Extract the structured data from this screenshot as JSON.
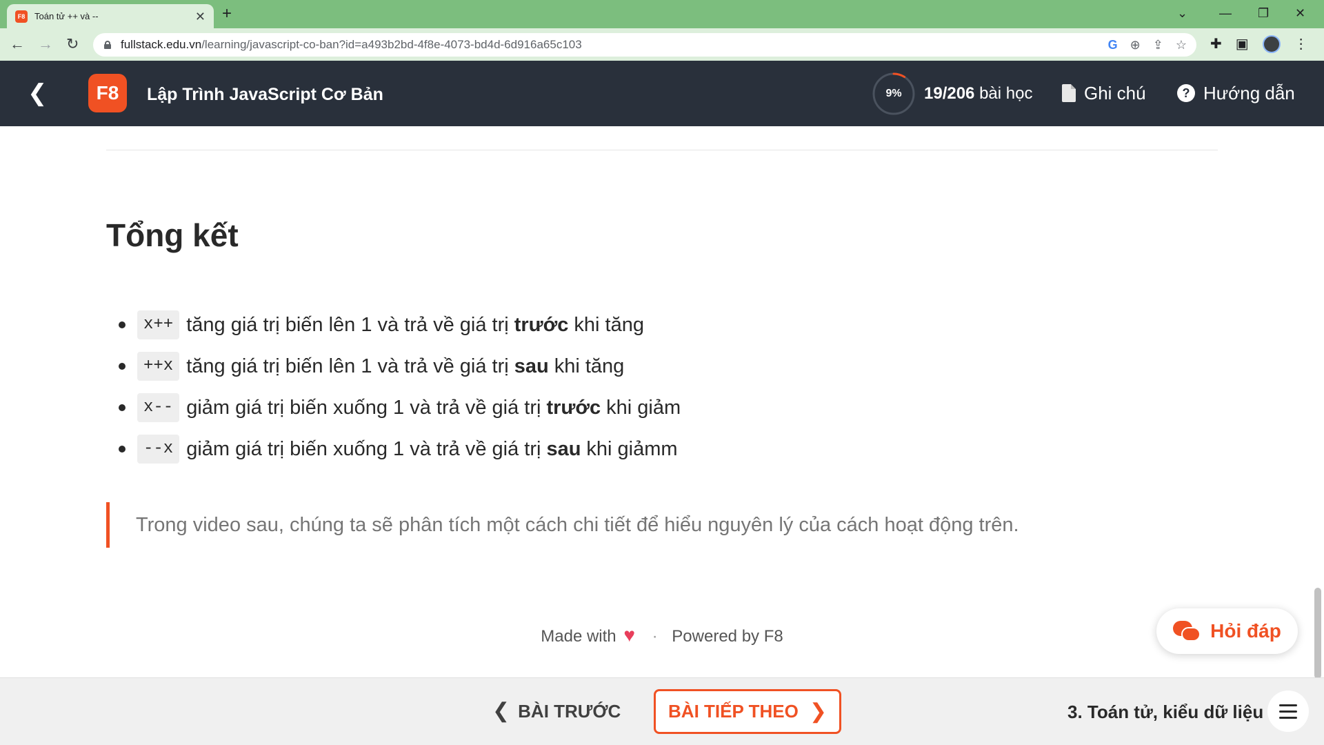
{
  "browser": {
    "tab_title": "Toán tử ++ và --",
    "favicon_text": "F8",
    "url_host": "fullstack.edu.vn",
    "url_path": "/learning/javascript-co-ban?id=a493b2bd-4f8e-4073-bd4d-6d916a65c103"
  },
  "header": {
    "logo_text": "F8",
    "course_title": "Lập Trình JavaScript Cơ Bản",
    "progress_percent": 9,
    "progress_label": "9%",
    "lessons_done": "19/206",
    "lessons_suffix": "bài học",
    "notes_label": "Ghi chú",
    "guide_label": "Hướng dẫn"
  },
  "content": {
    "heading": "Tổng kết",
    "bullets": [
      {
        "code": "x++",
        "text_before": "tăng giá trị biến lên 1 và trả về giá trị",
        "bold": "trước",
        "text_after": "khi tăng"
      },
      {
        "code": "++x",
        "text_before": "tăng giá trị biến lên 1 và trả về giá trị",
        "bold": "sau",
        "text_after": "khi tăng"
      },
      {
        "code": "x--",
        "text_before": "giảm giá trị biến xuống 1 và trả về giá trị",
        "bold": "trước",
        "text_after": "khi giảm"
      },
      {
        "code": "--x",
        "text_before": "giảm giá trị biến xuống 1 và trả về giá trị",
        "bold": "sau",
        "text_after": "khi giảmm"
      }
    ],
    "quote": "Trong video sau, chúng ta sẽ phân tích một cách chi tiết để hiểu nguyên lý của cách hoạt động trên."
  },
  "footer": {
    "made_with": "Made with",
    "heart": "♥",
    "separator": "·",
    "powered_by": "Powered by F8"
  },
  "help": {
    "label": "Hỏi đáp"
  },
  "bottom": {
    "prev_label": "BÀI TRƯỚC",
    "next_label": "BÀI TIẾP THEO",
    "section_label": "3. Toán tử, kiểu dữ liệu"
  },
  "colors": {
    "accent": "#f05123",
    "header_bg": "#29303b",
    "chrome_green": "#7cbe7e"
  }
}
